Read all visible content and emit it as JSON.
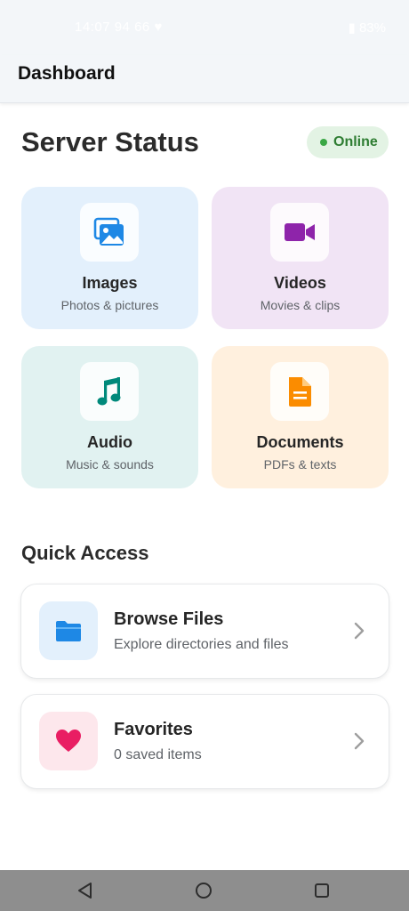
{
  "status_bar": {
    "time": "14:07",
    "left_extra": "94 66",
    "battery": "83%"
  },
  "app_bar": {
    "title": "Dashboard"
  },
  "server": {
    "title": "Server Status",
    "status": "Online",
    "status_color": "#3aa845"
  },
  "categories": [
    {
      "title": "Images",
      "subtitle": "Photos & pictures",
      "icon": "image-icon",
      "bg": "#e3f0fc",
      "accent": "#1e88e5"
    },
    {
      "title": "Videos",
      "subtitle": "Movies & clips",
      "icon": "video-camera-icon",
      "bg": "#f1e4f5",
      "accent": "#8e24aa"
    },
    {
      "title": "Audio",
      "subtitle": "Music & sounds",
      "icon": "music-note-icon",
      "bg": "#e1f2f1",
      "accent": "#00897b"
    },
    {
      "title": "Documents",
      "subtitle": "PDFs & texts",
      "icon": "document-icon",
      "bg": "#fff0de",
      "accent": "#fb8c00"
    }
  ],
  "quick_access": {
    "title": "Quick Access",
    "items": [
      {
        "title": "Browse Files",
        "subtitle": "Explore directories and files",
        "icon": "folder-icon",
        "bg": "#e3f0fc",
        "accent": "#1e88e5"
      },
      {
        "title": "Favorites",
        "subtitle": "0 saved items",
        "icon": "heart-icon",
        "bg": "#fde7ec",
        "accent": "#e91e63"
      }
    ]
  },
  "nav_bar": {
    "buttons": [
      "back-icon",
      "home-icon",
      "recents-icon"
    ]
  }
}
